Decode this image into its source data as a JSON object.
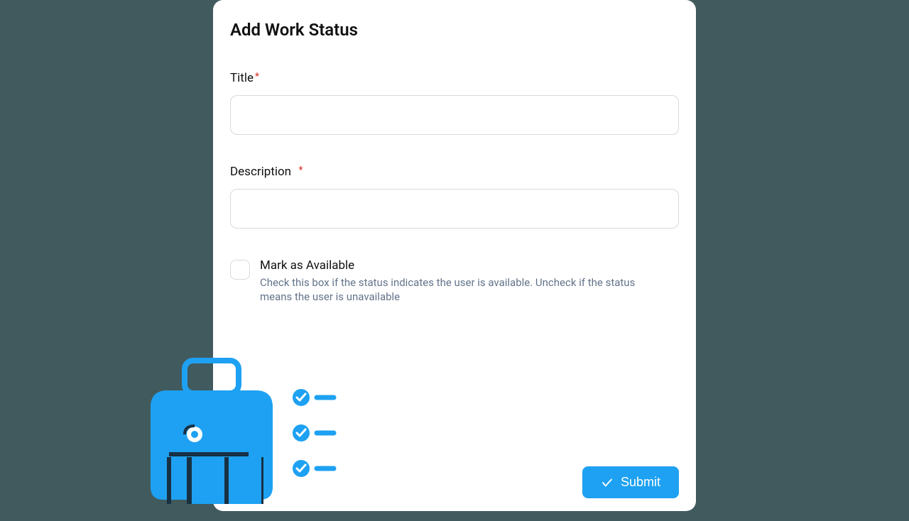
{
  "modal": {
    "title": "Add Work Status"
  },
  "form": {
    "title": {
      "label": "Title",
      "required": "*"
    },
    "description": {
      "label": "Description",
      "required": "*"
    },
    "available": {
      "label": "Mark as Available",
      "help": "Check this box if the status indicates the user is available. Uncheck if the status means the user is unavailable"
    },
    "submit": "Submit"
  },
  "colors": {
    "accent": "#1ea1f2"
  }
}
